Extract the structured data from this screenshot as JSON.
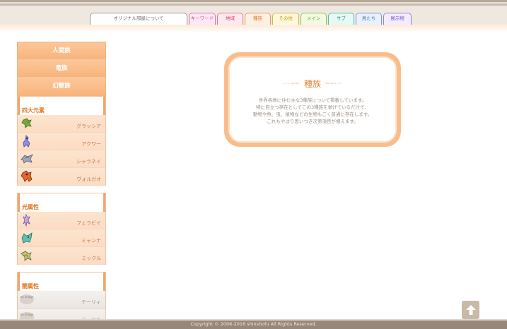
{
  "nav": {
    "tabs": [
      {
        "label": "オリジナル部屋について"
      },
      {
        "label": "キーワード"
      },
      {
        "label": "地域"
      },
      {
        "label": "種族"
      },
      {
        "label": "その他"
      },
      {
        "label": "メイン"
      },
      {
        "label": "サブ"
      },
      {
        "label": "鳥たち"
      },
      {
        "label": "展示物"
      }
    ]
  },
  "sidebar": {
    "races": [
      {
        "label": "人間族"
      },
      {
        "label": "竜族"
      },
      {
        "label": "幻獣族"
      }
    ],
    "groups": [
      {
        "title": "四大元素",
        "items": [
          {
            "name": "グラッシア",
            "icon": "green-creature-icon"
          },
          {
            "name": "アクワー",
            "icon": "blue-creature-icon"
          },
          {
            "name": "シャラネイ",
            "icon": "gray-bird-icon"
          },
          {
            "name": "ヴォルガオ",
            "icon": "red-beast-icon"
          }
        ]
      },
      {
        "title": "光属性",
        "items": [
          {
            "name": "フェラビイ",
            "icon": "violet-fairy-icon"
          },
          {
            "name": "ミャンナ",
            "icon": "teal-cat-icon"
          },
          {
            "name": "ミックル",
            "icon": "yellow-bird-icon"
          }
        ]
      },
      {
        "title": "闇属性",
        "items": [
          {
            "name": "テーリィ",
            "icon": "no-image-icon"
          },
          {
            "name": "テーニル",
            "icon": "no-image-icon"
          }
        ]
      }
    ],
    "no_image_label": "no image"
  },
  "main": {
    "title": "種族",
    "description": [
      "世界各地に住む主な3種族について掲載しています。",
      "特に目立つ存在としてこの3種族を挙げているだけで、",
      "動物や魚、虫、植物などの生物もごく普通に存在します。",
      "これもやはり思いつき次第項目が増えます。"
    ]
  },
  "footer": {
    "copyright": "Copyright © 2006-2016 shinshofu All Rights Reserved."
  },
  "colors": {
    "accent": "#e8842f",
    "card_border": "#f9bd8c",
    "footer_bg": "#97877a"
  }
}
